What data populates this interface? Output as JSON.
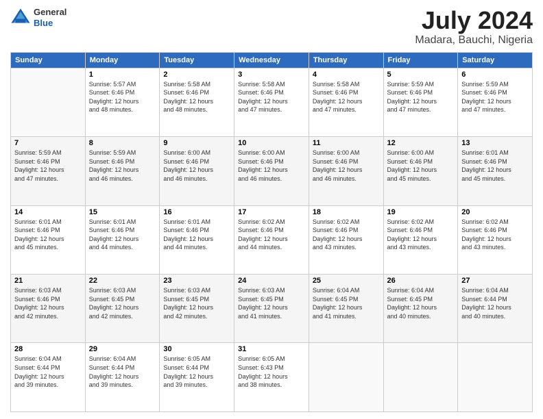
{
  "header": {
    "logo": {
      "line1": "General",
      "line2": "Blue"
    },
    "title": "July 2024",
    "subtitle": "Madara, Bauchi, Nigeria"
  },
  "days_of_week": [
    "Sunday",
    "Monday",
    "Tuesday",
    "Wednesday",
    "Thursday",
    "Friday",
    "Saturday"
  ],
  "weeks": [
    [
      {
        "day": "",
        "info": ""
      },
      {
        "day": "1",
        "info": "Sunrise: 5:57 AM\nSunset: 6:46 PM\nDaylight: 12 hours\nand 48 minutes."
      },
      {
        "day": "2",
        "info": "Sunrise: 5:58 AM\nSunset: 6:46 PM\nDaylight: 12 hours\nand 48 minutes."
      },
      {
        "day": "3",
        "info": "Sunrise: 5:58 AM\nSunset: 6:46 PM\nDaylight: 12 hours\nand 47 minutes."
      },
      {
        "day": "4",
        "info": "Sunrise: 5:58 AM\nSunset: 6:46 PM\nDaylight: 12 hours\nand 47 minutes."
      },
      {
        "day": "5",
        "info": "Sunrise: 5:59 AM\nSunset: 6:46 PM\nDaylight: 12 hours\nand 47 minutes."
      },
      {
        "day": "6",
        "info": "Sunrise: 5:59 AM\nSunset: 6:46 PM\nDaylight: 12 hours\nand 47 minutes."
      }
    ],
    [
      {
        "day": "7",
        "info": "Sunrise: 5:59 AM\nSunset: 6:46 PM\nDaylight: 12 hours\nand 47 minutes."
      },
      {
        "day": "8",
        "info": "Sunrise: 5:59 AM\nSunset: 6:46 PM\nDaylight: 12 hours\nand 46 minutes."
      },
      {
        "day": "9",
        "info": "Sunrise: 6:00 AM\nSunset: 6:46 PM\nDaylight: 12 hours\nand 46 minutes."
      },
      {
        "day": "10",
        "info": "Sunrise: 6:00 AM\nSunset: 6:46 PM\nDaylight: 12 hours\nand 46 minutes."
      },
      {
        "day": "11",
        "info": "Sunrise: 6:00 AM\nSunset: 6:46 PM\nDaylight: 12 hours\nand 46 minutes."
      },
      {
        "day": "12",
        "info": "Sunrise: 6:00 AM\nSunset: 6:46 PM\nDaylight: 12 hours\nand 45 minutes."
      },
      {
        "day": "13",
        "info": "Sunrise: 6:01 AM\nSunset: 6:46 PM\nDaylight: 12 hours\nand 45 minutes."
      }
    ],
    [
      {
        "day": "14",
        "info": "Sunrise: 6:01 AM\nSunset: 6:46 PM\nDaylight: 12 hours\nand 45 minutes."
      },
      {
        "day": "15",
        "info": "Sunrise: 6:01 AM\nSunset: 6:46 PM\nDaylight: 12 hours\nand 44 minutes."
      },
      {
        "day": "16",
        "info": "Sunrise: 6:01 AM\nSunset: 6:46 PM\nDaylight: 12 hours\nand 44 minutes."
      },
      {
        "day": "17",
        "info": "Sunrise: 6:02 AM\nSunset: 6:46 PM\nDaylight: 12 hours\nand 44 minutes."
      },
      {
        "day": "18",
        "info": "Sunrise: 6:02 AM\nSunset: 6:46 PM\nDaylight: 12 hours\nand 43 minutes."
      },
      {
        "day": "19",
        "info": "Sunrise: 6:02 AM\nSunset: 6:46 PM\nDaylight: 12 hours\nand 43 minutes."
      },
      {
        "day": "20",
        "info": "Sunrise: 6:02 AM\nSunset: 6:46 PM\nDaylight: 12 hours\nand 43 minutes."
      }
    ],
    [
      {
        "day": "21",
        "info": "Sunrise: 6:03 AM\nSunset: 6:46 PM\nDaylight: 12 hours\nand 42 minutes."
      },
      {
        "day": "22",
        "info": "Sunrise: 6:03 AM\nSunset: 6:45 PM\nDaylight: 12 hours\nand 42 minutes."
      },
      {
        "day": "23",
        "info": "Sunrise: 6:03 AM\nSunset: 6:45 PM\nDaylight: 12 hours\nand 42 minutes."
      },
      {
        "day": "24",
        "info": "Sunrise: 6:03 AM\nSunset: 6:45 PM\nDaylight: 12 hours\nand 41 minutes."
      },
      {
        "day": "25",
        "info": "Sunrise: 6:04 AM\nSunset: 6:45 PM\nDaylight: 12 hours\nand 41 minutes."
      },
      {
        "day": "26",
        "info": "Sunrise: 6:04 AM\nSunset: 6:45 PM\nDaylight: 12 hours\nand 40 minutes."
      },
      {
        "day": "27",
        "info": "Sunrise: 6:04 AM\nSunset: 6:44 PM\nDaylight: 12 hours\nand 40 minutes."
      }
    ],
    [
      {
        "day": "28",
        "info": "Sunrise: 6:04 AM\nSunset: 6:44 PM\nDaylight: 12 hours\nand 39 minutes."
      },
      {
        "day": "29",
        "info": "Sunrise: 6:04 AM\nSunset: 6:44 PM\nDaylight: 12 hours\nand 39 minutes."
      },
      {
        "day": "30",
        "info": "Sunrise: 6:05 AM\nSunset: 6:44 PM\nDaylight: 12 hours\nand 39 minutes."
      },
      {
        "day": "31",
        "info": "Sunrise: 6:05 AM\nSunset: 6:43 PM\nDaylight: 12 hours\nand 38 minutes."
      },
      {
        "day": "",
        "info": ""
      },
      {
        "day": "",
        "info": ""
      },
      {
        "day": "",
        "info": ""
      }
    ]
  ]
}
